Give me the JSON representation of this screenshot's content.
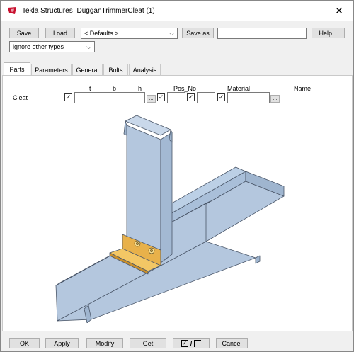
{
  "window": {
    "app": "Tekla Structures",
    "component": "DugganTrimmerCleat (1)",
    "close_glyph": "✕"
  },
  "toolbar": {
    "save_label": "Save",
    "load_label": "Load",
    "defaults_value": "< Defaults >",
    "save_as_label": "Save as",
    "save_as_value": "",
    "help_label": "Help...",
    "filter_value": "ignore other types"
  },
  "tabs": [
    {
      "label": "Parts",
      "active": true
    },
    {
      "label": "Parameters",
      "active": false
    },
    {
      "label": "General",
      "active": false
    },
    {
      "label": "Bolts",
      "active": false
    },
    {
      "label": "Analysis",
      "active": false
    }
  ],
  "parts": {
    "headers": {
      "t": "t",
      "b": "b",
      "h": "h",
      "pos_no": "Pos_No",
      "material": "Material",
      "name": "Name"
    },
    "row_label": "Cleat",
    "profile_value": "",
    "pos_prefix": "",
    "pos_start": "",
    "material_value": "",
    "ellipsis": "...",
    "checked": true
  },
  "footer": {
    "ok_label": "OK",
    "apply_label": "Apply",
    "modify_label": "Modify",
    "get_label": "Get",
    "toggle_label": "/",
    "cancel_label": "Cancel"
  },
  "colors": {
    "steel": "#b4c7de",
    "steel_edge": "#4a5668",
    "cleat": "#f0b84c",
    "accent": "#c8102e"
  }
}
